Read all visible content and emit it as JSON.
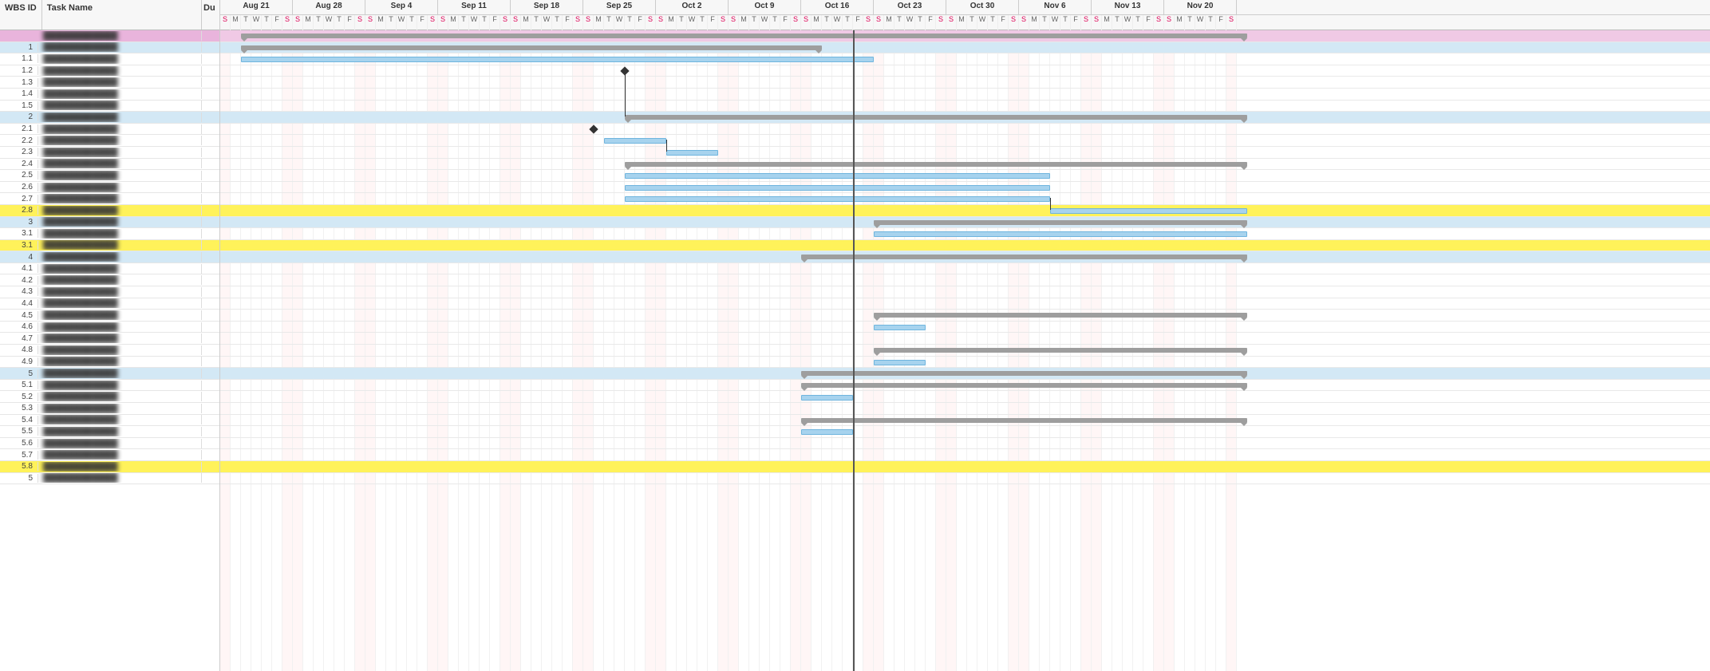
{
  "chart_data": {
    "type": "gantt",
    "date_range_start": "2023-08-20",
    "date_range_end": "2023-11-26",
    "today_marker_date": "2023-10-20",
    "weeks": [
      "Aug 21",
      "Aug 28",
      "Sep 4",
      "Sep 11",
      "Sep 18",
      "Sep 25",
      "Oct 2",
      "Oct 9",
      "Oct 16",
      "Oct 23",
      "Oct 30",
      "Nov 6",
      "Nov 13",
      "Nov 20"
    ],
    "day_labels": [
      "S",
      "M",
      "T",
      "W",
      "T",
      "F",
      "S"
    ],
    "rows": [
      {
        "wbs": "",
        "kind": "project",
        "highlight": "project",
        "bar": {
          "type": "summary",
          "start": 2,
          "end": 99
        }
      },
      {
        "wbs": "1",
        "kind": "group",
        "bar": {
          "type": "summary",
          "start": 2,
          "end": 58
        }
      },
      {
        "wbs": "1.1",
        "kind": "task",
        "bar": {
          "type": "task",
          "start": 2,
          "end": 63
        }
      },
      {
        "wbs": "1.2",
        "kind": "task",
        "milestone": {
          "day": 39
        }
      },
      {
        "wbs": "1.3",
        "kind": "task"
      },
      {
        "wbs": "1.4",
        "kind": "task"
      },
      {
        "wbs": "1.5",
        "kind": "task"
      },
      {
        "wbs": "2",
        "kind": "group",
        "bar": {
          "type": "summary",
          "start": 39,
          "end": 99
        }
      },
      {
        "wbs": "2.1",
        "kind": "task",
        "milestone": {
          "day": 36
        }
      },
      {
        "wbs": "2.2",
        "kind": "task",
        "bar": {
          "type": "task",
          "start": 37,
          "end": 43
        }
      },
      {
        "wbs": "2.3",
        "kind": "task",
        "bar": {
          "type": "task",
          "start": 43,
          "end": 48
        }
      },
      {
        "wbs": "2.4",
        "kind": "task",
        "bar": {
          "type": "summary",
          "start": 39,
          "end": 99
        }
      },
      {
        "wbs": "2.5",
        "kind": "task",
        "bar": {
          "type": "task",
          "start": 39,
          "end": 80
        }
      },
      {
        "wbs": "2.6",
        "kind": "task",
        "bar": {
          "type": "task",
          "start": 39,
          "end": 80
        }
      },
      {
        "wbs": "2.7",
        "kind": "task",
        "bar": {
          "type": "task",
          "start": 39,
          "end": 80
        }
      },
      {
        "wbs": "2.8",
        "kind": "task",
        "highlight": "hl",
        "bar": {
          "type": "task",
          "start": 80,
          "end": 99
        }
      },
      {
        "wbs": "3",
        "kind": "group",
        "bar": {
          "type": "summary",
          "start": 63,
          "end": 99
        }
      },
      {
        "wbs": "3.1",
        "kind": "task",
        "bar": {
          "type": "task",
          "start": 63,
          "end": 99
        }
      },
      {
        "wbs": "3.1",
        "kind": "task",
        "highlight": "hl"
      },
      {
        "wbs": "4",
        "kind": "group",
        "bar": {
          "type": "summary",
          "start": 56,
          "end": 99
        }
      },
      {
        "wbs": "4.1",
        "kind": "task"
      },
      {
        "wbs": "4.2",
        "kind": "task"
      },
      {
        "wbs": "4.3",
        "kind": "task"
      },
      {
        "wbs": "4.4",
        "kind": "task"
      },
      {
        "wbs": "4.5",
        "kind": "task",
        "bar": {
          "type": "summary",
          "start": 63,
          "end": 99
        }
      },
      {
        "wbs": "4.6",
        "kind": "task",
        "bar": {
          "type": "task",
          "start": 63,
          "end": 68
        }
      },
      {
        "wbs": "4.7",
        "kind": "task"
      },
      {
        "wbs": "4.8",
        "kind": "task",
        "bar": {
          "type": "summary",
          "start": 63,
          "end": 99
        }
      },
      {
        "wbs": "4.9",
        "kind": "task",
        "bar": {
          "type": "task",
          "start": 63,
          "end": 68
        }
      },
      {
        "wbs": "5",
        "kind": "group",
        "bar": {
          "type": "summary",
          "start": 56,
          "end": 99
        }
      },
      {
        "wbs": "5.1",
        "kind": "task",
        "bar": {
          "type": "summary",
          "start": 56,
          "end": 99
        }
      },
      {
        "wbs": "5.2",
        "kind": "task",
        "bar": {
          "type": "task",
          "start": 56,
          "end": 61
        }
      },
      {
        "wbs": "5.3",
        "kind": "task"
      },
      {
        "wbs": "5.4",
        "kind": "task",
        "bar": {
          "type": "summary",
          "start": 56,
          "end": 99
        }
      },
      {
        "wbs": "5.5",
        "kind": "task",
        "bar": {
          "type": "task",
          "start": 56,
          "end": 61
        }
      },
      {
        "wbs": "5.6",
        "kind": "task"
      },
      {
        "wbs": "5.7",
        "kind": "task"
      },
      {
        "wbs": "5.8",
        "kind": "task",
        "highlight": "hl"
      },
      {
        "wbs": "5",
        "kind": "task"
      }
    ]
  },
  "headers": {
    "wbs": "WBS ID",
    "task": "Task Name",
    "du": "Du"
  },
  "colors": {
    "project_row": "#e9b4dc",
    "group_row": "#d3e8f5",
    "highlight_row": "#fff25a",
    "summary_bar": "#9e9e9e",
    "task_bar_fill": "#a7d3ee",
    "task_bar_border": "#6fb5de",
    "weekend_text": "#d05",
    "today_line": "#555"
  }
}
